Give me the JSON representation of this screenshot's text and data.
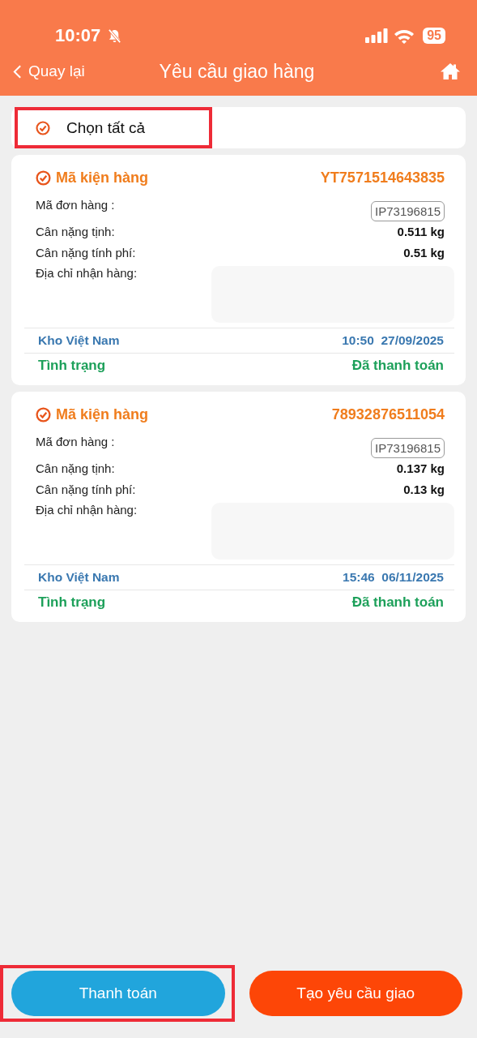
{
  "status_bar": {
    "time": "10:07",
    "muted": true,
    "battery": "95"
  },
  "nav": {
    "back": "Quay lại",
    "title": "Yêu cầu giao hàng"
  },
  "select_all": {
    "label": "Chọn tất cả",
    "checked": true,
    "highlighted": true
  },
  "packages": [
    {
      "checked": true,
      "title": "Mã kiện hàng",
      "code": "YT7571514643835",
      "order_label": "Mã đơn hàng :",
      "order": "IP73196815",
      "net_label": "Cân nặng tịnh:",
      "net": "0.511 kg",
      "charge_label": "Cân nặng tính phí:",
      "charge": "0.51 kg",
      "address_label": "Địa chỉ nhận hàng:",
      "warehouse": "Kho Việt Nam",
      "time": "10:50  27/09/2025",
      "status_label": "Tình trạng",
      "status": "Đã thanh toán"
    },
    {
      "checked": true,
      "title": "Mã kiện hàng",
      "code": "78932876511054",
      "order_label": "Mã đơn hàng :",
      "order": "IP73196815",
      "net_label": "Cân nặng tịnh:",
      "net": "0.137 kg",
      "charge_label": "Cân nặng tính phí:",
      "charge": "0.13 kg",
      "address_label": "Địa chỉ nhận hàng:",
      "warehouse": "Kho Việt Nam",
      "time": "15:46  06/11/2025",
      "status_label": "Tình trạng",
      "status": "Đã thanh toán"
    }
  ],
  "buttons": [
    {
      "label": "Thanh toán",
      "kind": "pay",
      "highlighted": true
    },
    {
      "label": "Tạo yêu cầu giao",
      "kind": "create",
      "highlighted": false
    }
  ]
}
